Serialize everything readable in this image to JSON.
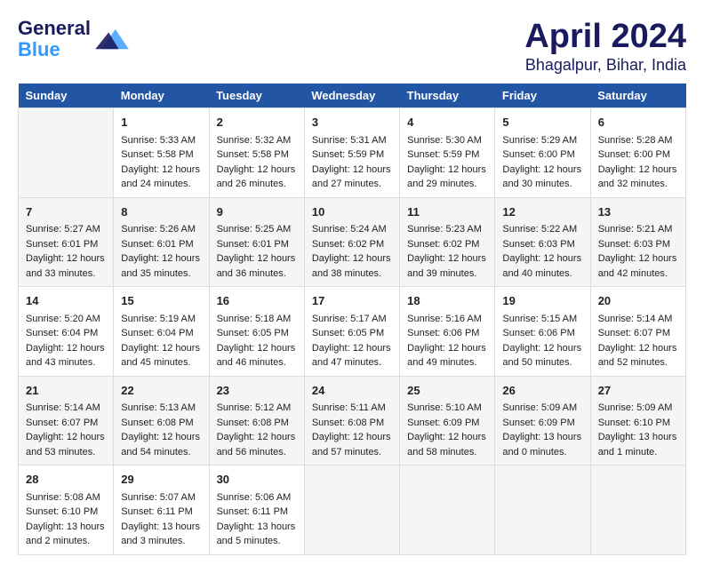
{
  "header": {
    "logo_line1": "General",
    "logo_line2": "Blue",
    "month": "April 2024",
    "location": "Bhagalpur, Bihar, India"
  },
  "weekdays": [
    "Sunday",
    "Monday",
    "Tuesday",
    "Wednesday",
    "Thursday",
    "Friday",
    "Saturday"
  ],
  "weeks": [
    [
      {
        "day": "",
        "info": ""
      },
      {
        "day": "1",
        "info": "Sunrise: 5:33 AM\nSunset: 5:58 PM\nDaylight: 12 hours\nand 24 minutes."
      },
      {
        "day": "2",
        "info": "Sunrise: 5:32 AM\nSunset: 5:58 PM\nDaylight: 12 hours\nand 26 minutes."
      },
      {
        "day": "3",
        "info": "Sunrise: 5:31 AM\nSunset: 5:59 PM\nDaylight: 12 hours\nand 27 minutes."
      },
      {
        "day": "4",
        "info": "Sunrise: 5:30 AM\nSunset: 5:59 PM\nDaylight: 12 hours\nand 29 minutes."
      },
      {
        "day": "5",
        "info": "Sunrise: 5:29 AM\nSunset: 6:00 PM\nDaylight: 12 hours\nand 30 minutes."
      },
      {
        "day": "6",
        "info": "Sunrise: 5:28 AM\nSunset: 6:00 PM\nDaylight: 12 hours\nand 32 minutes."
      }
    ],
    [
      {
        "day": "7",
        "info": "Sunrise: 5:27 AM\nSunset: 6:01 PM\nDaylight: 12 hours\nand 33 minutes."
      },
      {
        "day": "8",
        "info": "Sunrise: 5:26 AM\nSunset: 6:01 PM\nDaylight: 12 hours\nand 35 minutes."
      },
      {
        "day": "9",
        "info": "Sunrise: 5:25 AM\nSunset: 6:01 PM\nDaylight: 12 hours\nand 36 minutes."
      },
      {
        "day": "10",
        "info": "Sunrise: 5:24 AM\nSunset: 6:02 PM\nDaylight: 12 hours\nand 38 minutes."
      },
      {
        "day": "11",
        "info": "Sunrise: 5:23 AM\nSunset: 6:02 PM\nDaylight: 12 hours\nand 39 minutes."
      },
      {
        "day": "12",
        "info": "Sunrise: 5:22 AM\nSunset: 6:03 PM\nDaylight: 12 hours\nand 40 minutes."
      },
      {
        "day": "13",
        "info": "Sunrise: 5:21 AM\nSunset: 6:03 PM\nDaylight: 12 hours\nand 42 minutes."
      }
    ],
    [
      {
        "day": "14",
        "info": "Sunrise: 5:20 AM\nSunset: 6:04 PM\nDaylight: 12 hours\nand 43 minutes."
      },
      {
        "day": "15",
        "info": "Sunrise: 5:19 AM\nSunset: 6:04 PM\nDaylight: 12 hours\nand 45 minutes."
      },
      {
        "day": "16",
        "info": "Sunrise: 5:18 AM\nSunset: 6:05 PM\nDaylight: 12 hours\nand 46 minutes."
      },
      {
        "day": "17",
        "info": "Sunrise: 5:17 AM\nSunset: 6:05 PM\nDaylight: 12 hours\nand 47 minutes."
      },
      {
        "day": "18",
        "info": "Sunrise: 5:16 AM\nSunset: 6:06 PM\nDaylight: 12 hours\nand 49 minutes."
      },
      {
        "day": "19",
        "info": "Sunrise: 5:15 AM\nSunset: 6:06 PM\nDaylight: 12 hours\nand 50 minutes."
      },
      {
        "day": "20",
        "info": "Sunrise: 5:14 AM\nSunset: 6:07 PM\nDaylight: 12 hours\nand 52 minutes."
      }
    ],
    [
      {
        "day": "21",
        "info": "Sunrise: 5:14 AM\nSunset: 6:07 PM\nDaylight: 12 hours\nand 53 minutes."
      },
      {
        "day": "22",
        "info": "Sunrise: 5:13 AM\nSunset: 6:08 PM\nDaylight: 12 hours\nand 54 minutes."
      },
      {
        "day": "23",
        "info": "Sunrise: 5:12 AM\nSunset: 6:08 PM\nDaylight: 12 hours\nand 56 minutes."
      },
      {
        "day": "24",
        "info": "Sunrise: 5:11 AM\nSunset: 6:08 PM\nDaylight: 12 hours\nand 57 minutes."
      },
      {
        "day": "25",
        "info": "Sunrise: 5:10 AM\nSunset: 6:09 PM\nDaylight: 12 hours\nand 58 minutes."
      },
      {
        "day": "26",
        "info": "Sunrise: 5:09 AM\nSunset: 6:09 PM\nDaylight: 13 hours\nand 0 minutes."
      },
      {
        "day": "27",
        "info": "Sunrise: 5:09 AM\nSunset: 6:10 PM\nDaylight: 13 hours\nand 1 minute."
      }
    ],
    [
      {
        "day": "28",
        "info": "Sunrise: 5:08 AM\nSunset: 6:10 PM\nDaylight: 13 hours\nand 2 minutes."
      },
      {
        "day": "29",
        "info": "Sunrise: 5:07 AM\nSunset: 6:11 PM\nDaylight: 13 hours\nand 3 minutes."
      },
      {
        "day": "30",
        "info": "Sunrise: 5:06 AM\nSunset: 6:11 PM\nDaylight: 13 hours\nand 5 minutes."
      },
      {
        "day": "",
        "info": ""
      },
      {
        "day": "",
        "info": ""
      },
      {
        "day": "",
        "info": ""
      },
      {
        "day": "",
        "info": ""
      }
    ]
  ]
}
